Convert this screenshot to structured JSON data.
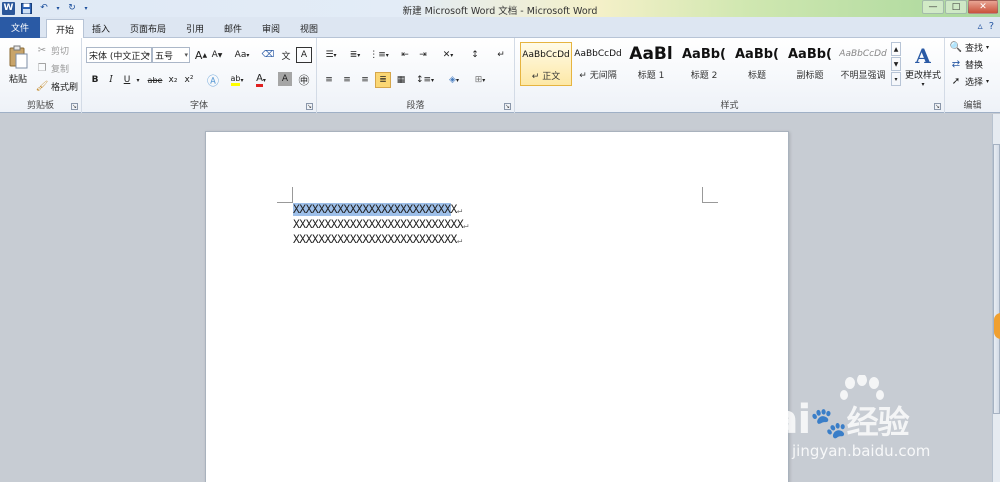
{
  "titlebar": {
    "title": "新建 Microsoft Word 文档 - Microsoft Word",
    "app_icon_letter": "W",
    "window_buttons": [
      "—",
      "□",
      "✕"
    ]
  },
  "tabs": [
    {
      "label": "文件",
      "active": false
    },
    {
      "label": "开始",
      "active": true
    },
    {
      "label": "插入",
      "active": false
    },
    {
      "label": "页面布局",
      "active": false
    },
    {
      "label": "引用",
      "active": false
    },
    {
      "label": "邮件",
      "active": false
    },
    {
      "label": "审阅",
      "active": false
    },
    {
      "label": "视图",
      "active": false
    }
  ],
  "clipboard": {
    "label": "剪贴板",
    "paste": "粘贴",
    "cut": "剪切",
    "copy": "复制",
    "format_painter": "格式刷"
  },
  "font": {
    "label": "字体",
    "font_name": "宋体 (中文正文",
    "font_size": "五号",
    "grow": "A",
    "shrink": "A",
    "case": "Aa",
    "bold": "B",
    "italic": "I",
    "underline": "U",
    "strike": "abe",
    "subscript": "x₂",
    "superscript": "x²",
    "font_color": "A",
    "char_shade": "A"
  },
  "paragraph": {
    "label": "段落"
  },
  "styles": {
    "label": "样式",
    "change_styles": "更改样式",
    "items": [
      {
        "sample": "AaBbCcDd",
        "name": "↵ 正文"
      },
      {
        "sample": "AaBbCcDd",
        "name": "↵ 无间隔"
      },
      {
        "sample": "AaBl",
        "name": "标题 1"
      },
      {
        "sample": "AaBb(",
        "name": "标题 2"
      },
      {
        "sample": "AaBb(",
        "name": "标题"
      },
      {
        "sample": "AaBb(",
        "name": "副标题"
      },
      {
        "sample": "AaBbCcDd",
        "name": "不明显强调"
      }
    ]
  },
  "editing": {
    "label": "编辑",
    "find": "查找",
    "replace": "替换",
    "select": "选择"
  },
  "document": {
    "lines": [
      {
        "selected": "XXXXXXXXXXXXXXXXXXXXXXXXX",
        "rest": "X"
      },
      {
        "selected": "",
        "rest": "XXXXXXXXXXXXXXXXXXXXXXXXXXX"
      },
      {
        "selected": "",
        "rest": "XXXXXXXXXXXXXXXXXXXXXXXXXX"
      }
    ],
    "paragraph_mark": "↵"
  },
  "watermark": {
    "brand": "Bai",
    "brand2": "经验",
    "url": "jingyan.baidu.com"
  },
  "colors": {
    "file_tab": "#2a5aa5",
    "selection": "#9dbfe9"
  }
}
